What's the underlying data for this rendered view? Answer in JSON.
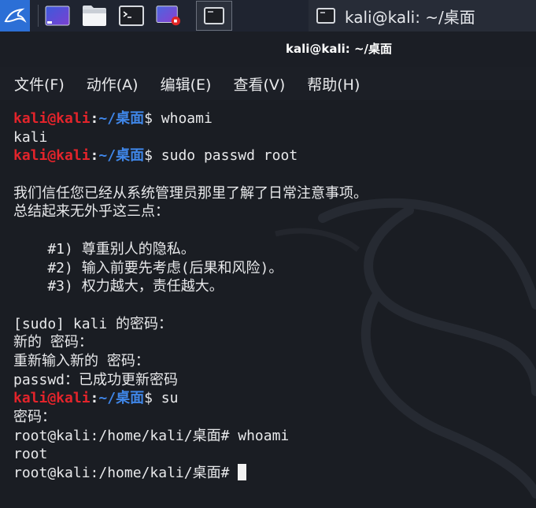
{
  "taskbar": {
    "launcher_icon": "kali-dragon-icon",
    "apps": [
      {
        "name": "desktop-icon"
      },
      {
        "name": "files-icon"
      },
      {
        "name": "terminal-icon"
      },
      {
        "name": "screen-recorder-icon"
      }
    ],
    "active_app_icon": "terminal-icon",
    "window_title": "kali@kali: ~/桌面"
  },
  "window": {
    "title": "kali@kali: ~/桌面"
  },
  "menu": {
    "items": [
      "文件(F)",
      "动作(A)",
      "编辑(E)",
      "查看(V)",
      "帮助(H)"
    ]
  },
  "colors": {
    "prompt_user": "#e3242b",
    "prompt_path": "#3f86e8",
    "text": "#e8e9eb",
    "background": "#1a1d23"
  },
  "terminal": {
    "prompt_user": "kali@kali",
    "prompt_sep": ":",
    "prompt_path": "~/桌面",
    "prompt_symbol": "$",
    "cmd_whoami": "whoami",
    "out_whoami": "kali",
    "cmd_passwd": "sudo passwd root",
    "lecture_1": "我们信任您已经从系统管理员那里了解了日常注意事项。",
    "lecture_2": "总结起来无外乎这三点：",
    "lecture_3": "    #1) 尊重别人的隐私。",
    "lecture_4": "    #2) 输入前要先考虑(后果和风险)。",
    "lecture_5": "    #3) 权力越大，责任越大。",
    "sudo_password": "[sudo] kali 的密码：",
    "new_password": "新的 密码：",
    "retype_password": "重新输入新的 密码：",
    "passwd_success": "passwd：已成功更新密码",
    "cmd_su": "su",
    "su_password": "密码：",
    "root_prompt_1": "root@kali:/home/kali/桌面# ",
    "root_cmd_whoami": "whoami",
    "root_out": "root",
    "root_prompt_2": "root@kali:/home/kali/桌面# "
  }
}
